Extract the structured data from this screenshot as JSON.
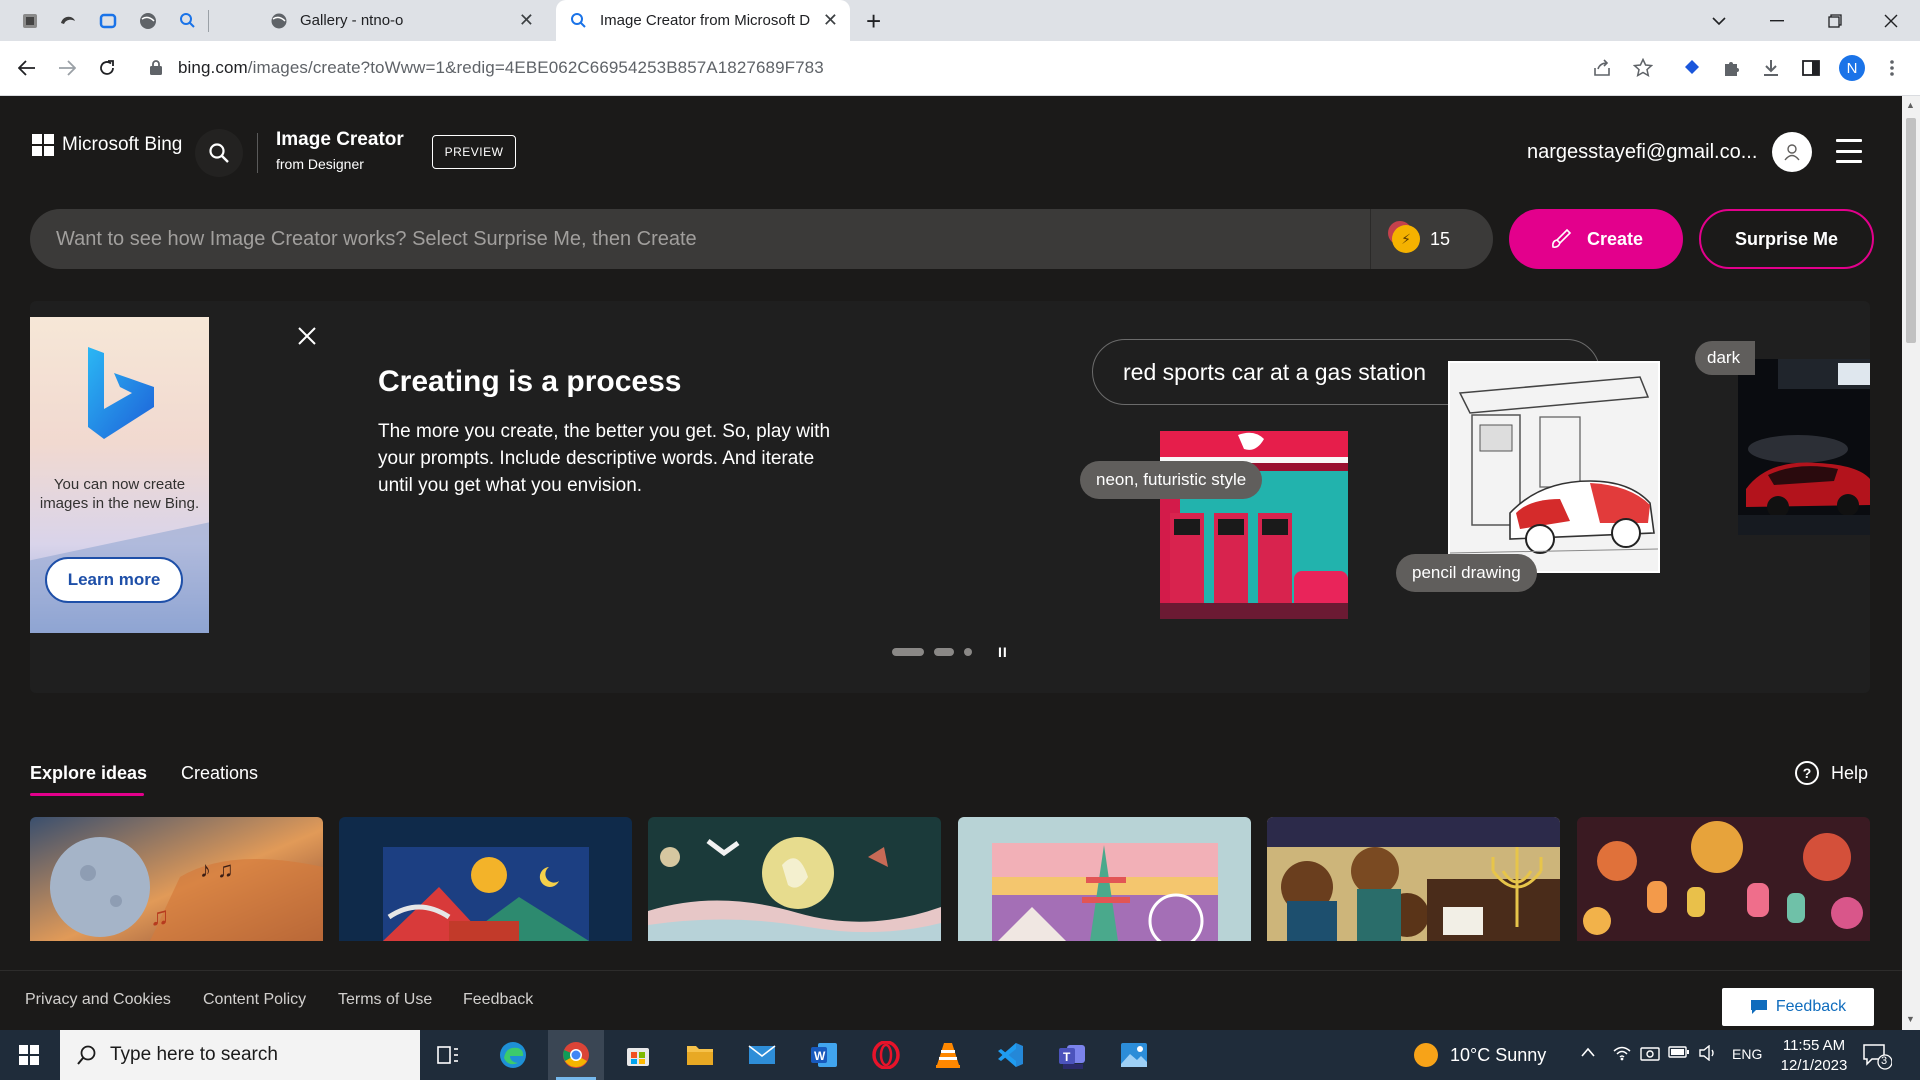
{
  "browser": {
    "tabs": [
      {
        "title": "Gallery - ntno-o",
        "active": false
      },
      {
        "title": "Image Creator from Microsoft D",
        "active": true
      }
    ],
    "url": "bing.com/images/create?toWww=1&redig=4EBE062C66954253B857A1827689F783",
    "url_host": "bing.com",
    "url_path": "/images/create?toWww=1&redig=4EBE062C66954253B857A1827689F783",
    "profile_initial": "N",
    "new_tab_symbol": "+"
  },
  "header": {
    "brand": "Microsoft Bing",
    "product_title": "Image Creator",
    "product_subtitle": "from Designer",
    "preview_badge": "PREVIEW",
    "user_email": "nargesstayefi@gmail.co..."
  },
  "prompt": {
    "placeholder": "Want to see how Image Creator works? Select Surprise Me, then Create",
    "boosts": "15",
    "create_label": "Create",
    "surprise_label": "Surprise Me"
  },
  "carousel": {
    "promo_text": "You can now create images in the new Bing.",
    "promo_button": "Learn more",
    "title": "Creating is a process",
    "description": "The more you create, the better you get. So, play with your prompts. Include descriptive words. And iterate until you get what you envision.",
    "prompt_example": "red sports car at a gas station",
    "chip_neon": "neon, futuristic style",
    "chip_pencil": "pencil drawing",
    "chip_dark": "dark",
    "pause_symbol": "II"
  },
  "explore": {
    "tab_explore": "Explore ideas",
    "tab_creations": "Creations",
    "help": "Help",
    "thumbnails": [
      "moon-music",
      "felt-landscape",
      "wool-night-sky",
      "paper-pagoda",
      "illustrated-menorah",
      "lanterns"
    ]
  },
  "footer": {
    "links": [
      "Privacy and Cookies",
      "Content Policy",
      "Terms of Use",
      "Feedback"
    ],
    "feedback_button": "Feedback"
  },
  "taskbar": {
    "search_placeholder": "Type here to search",
    "weather": "10°C  Sunny",
    "language": "ENG",
    "time": "11:55 AM",
    "date": "12/1/2023",
    "notification_count": "3"
  },
  "colors": {
    "accent": "#e3008c",
    "page_bg": "#1b1a19",
    "prompt_bg": "#3b3a39",
    "taskbar_bg": "#1f2c3a"
  }
}
